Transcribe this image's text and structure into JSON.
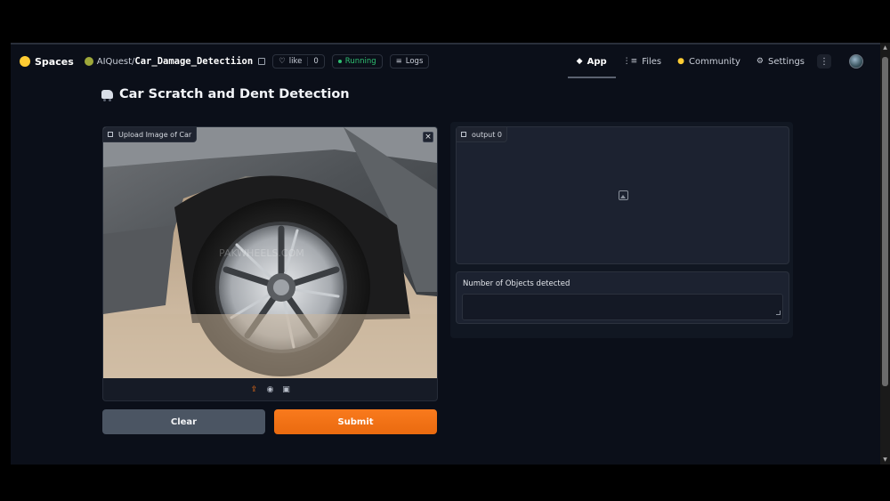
{
  "topbar": {
    "brand": "Spaces",
    "owner": "AIQuest/",
    "repo": "Car_Damage_Detectiion",
    "like_label": "like",
    "like_count": "0",
    "status": "Running",
    "logs_label": "Logs"
  },
  "nav": {
    "app": "App",
    "files": "Files",
    "community": "Community",
    "settings": "Settings",
    "more": "⋮"
  },
  "page": {
    "title": "Car Scratch and Dent Detection"
  },
  "input": {
    "label": "Upload Image of Car",
    "close": "×",
    "watermark": "PAKWHEELS.COM"
  },
  "output": {
    "label": "output 0"
  },
  "count": {
    "label": "Number of Objects detected",
    "value": ""
  },
  "buttons": {
    "clear": "Clear",
    "submit": "Submit"
  },
  "colors": {
    "background": "#0b0f19",
    "panel": "#1c2230",
    "accent": "#f97316",
    "running": "#2fbf71",
    "clear_button": "#4b5563"
  },
  "icons": {
    "upload": "upload-icon",
    "webcam": "webcam-icon",
    "clipboard": "clipboard-icon",
    "image_placeholder": "image-icon"
  }
}
